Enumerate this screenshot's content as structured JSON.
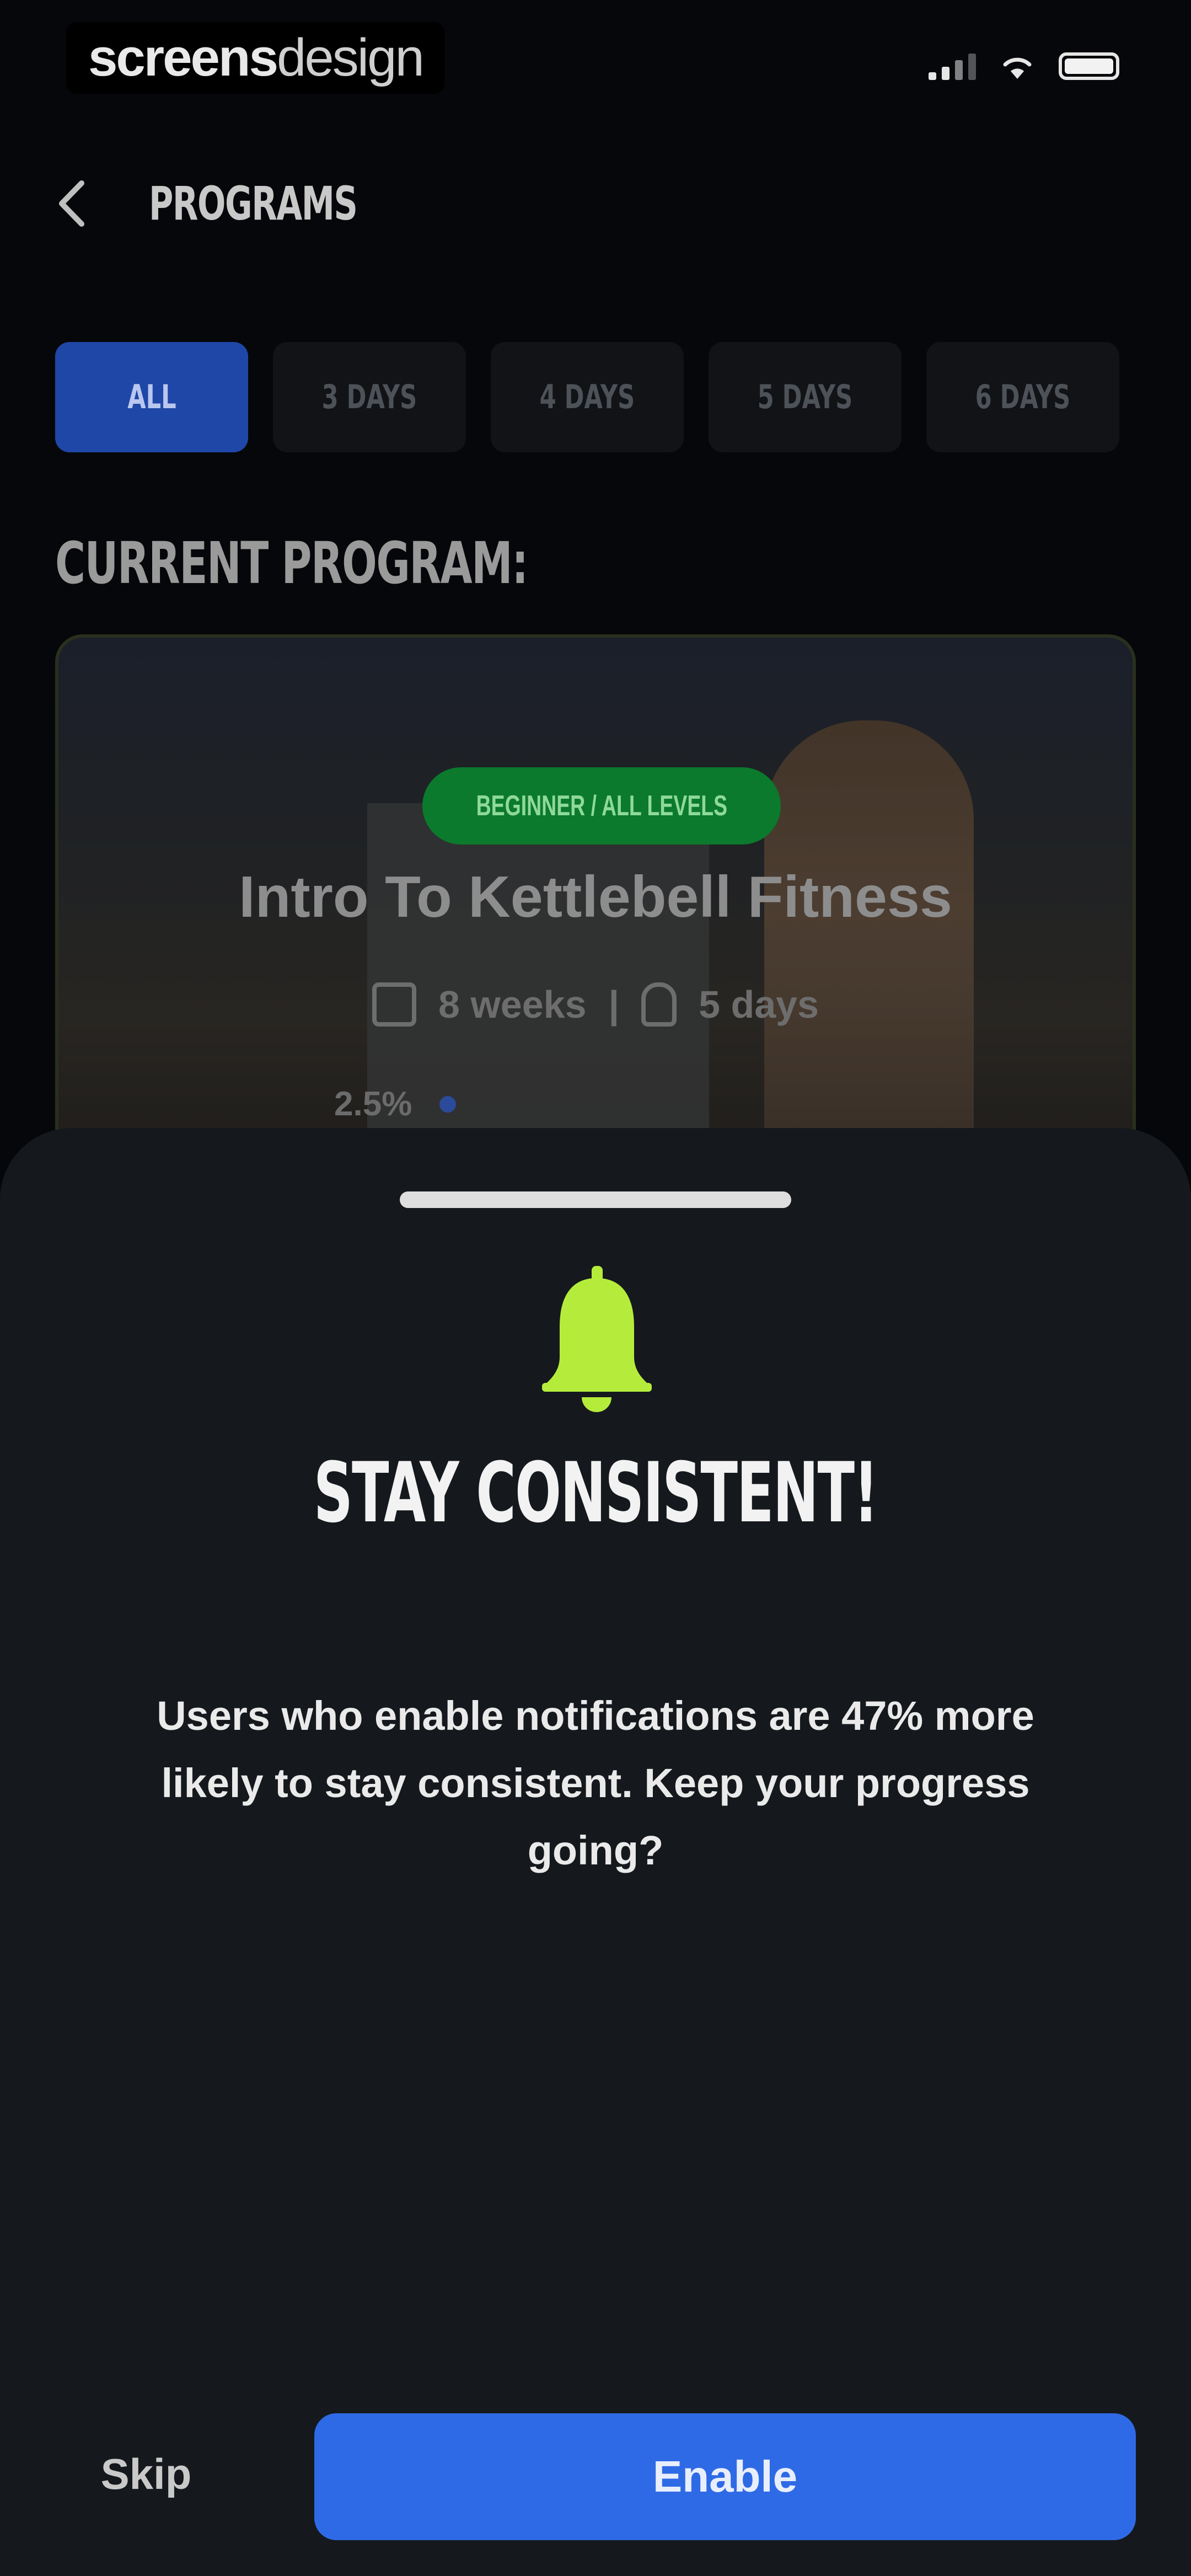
{
  "status_bar": {
    "brand_bold": "screens",
    "brand_light": "design"
  },
  "header": {
    "title": "PROGRAMS"
  },
  "filters": [
    {
      "label": "ALL",
      "active": true
    },
    {
      "label": "3 DAYS",
      "active": false
    },
    {
      "label": "4 DAYS",
      "active": false
    },
    {
      "label": "5 DAYS",
      "active": false
    },
    {
      "label": "6 DAYS",
      "active": false
    }
  ],
  "current_program": {
    "section_label": "CURRENT PROGRAM:",
    "level": "BEGINNER / ALL LEVELS",
    "title": "Intro To Kettlebell Fitness",
    "weeks": "8 weeks",
    "separator": "|",
    "days": "5 days",
    "progress": "2.5%"
  },
  "sheet": {
    "title": "STAY CONSISTENT!",
    "body": "Users who enable notifications are 47% more likely to stay consistent. Keep your progress going?",
    "skip_label": "Skip",
    "enable_label": "Enable"
  },
  "colors": {
    "accent_blue": "#2f6ae6",
    "bell_green": "#b5ec3c",
    "sheet_bg": "#15191d",
    "badge_green": "#0b7a2c"
  }
}
